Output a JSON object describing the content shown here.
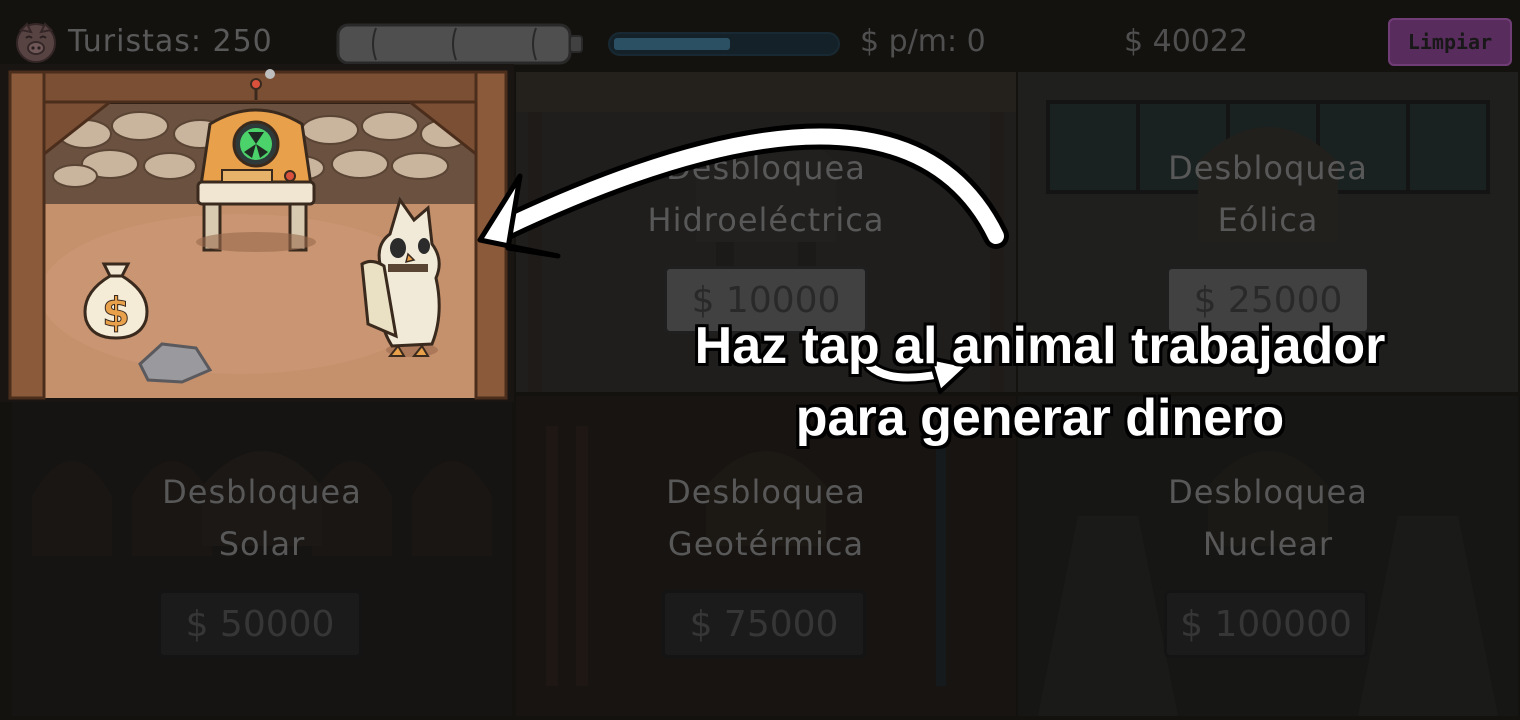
{
  "header": {
    "tourists_label": "Turistas: 250",
    "energy_level": 0.52,
    "money_per_minute": "$ p/m: 0",
    "money": "$ 40022",
    "clear_button": "Limpiar"
  },
  "rooms": [
    {
      "line1": "Desbloquea",
      "line2": "Hidroeléctrica",
      "price": "$ 10000"
    },
    {
      "line1": "Desbloquea",
      "line2": "Eólica",
      "price": "$ 25000"
    },
    {
      "line1": "Desbloquea",
      "line2": "Solar",
      "price": "$ 50000"
    },
    {
      "line1": "Desbloquea",
      "line2": "Geotérmica",
      "price": "$ 75000"
    },
    {
      "line1": "Desbloquea",
      "line2": "Nuclear",
      "price": "$ 100000"
    }
  ],
  "tutorial": {
    "line1": "Haz tap al animal trabajador",
    "line2": "para generar dinero"
  },
  "icons": {
    "money_bag": "$"
  },
  "colors": {
    "clear_button": "#7a3e80",
    "energy_fill": "#3d6f8a"
  }
}
